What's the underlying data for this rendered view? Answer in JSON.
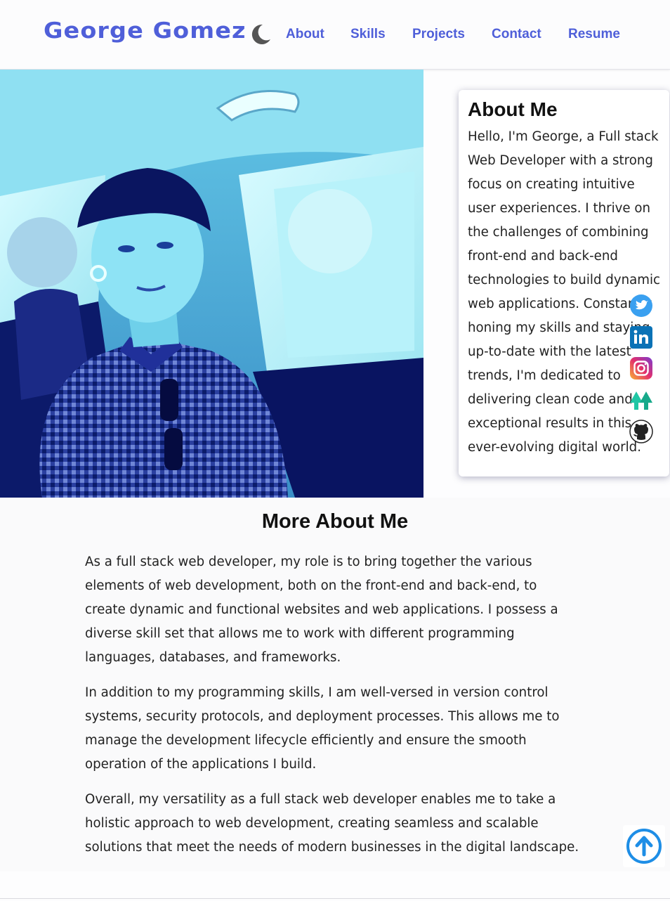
{
  "header": {
    "brand": "George Gomez",
    "theme_toggle_icon": "moon-icon",
    "nav": [
      {
        "label": "About"
      },
      {
        "label": "Skills"
      },
      {
        "label": "Projects"
      },
      {
        "label": "Contact"
      },
      {
        "label": "Resume"
      }
    ],
    "accent_color": "#4f5fd9"
  },
  "about": {
    "title": "About Me",
    "text": "Hello, I'm George, a Full stack Web Developer with a strong focus on creating intuitive user experiences. I thrive on the challenges of combining front-end and back-end technologies to build dynamic web applications. Constantly honing my skills and staying up-to-date with the latest trends, I'm dedicated to delivering clean code and exceptional results in this ever-evolving digital world."
  },
  "social_icons": [
    "twitter-icon",
    "linkedin-icon",
    "instagram-icon",
    "upwork-icon",
    "github-icon"
  ],
  "more": {
    "title": "More About Me",
    "paragraphs": [
      "As a full stack web developer, my role is to bring together the various elements of web development, both on the front-end and back-end, to create dynamic and functional websites and web applications. I possess a diverse skill set that allows me to work with different programming languages, databases, and frameworks.",
      "In addition to my programming skills, I am well-versed in version control systems, security protocols, and deployment processes. This allows me to manage the development lifecycle efficiently and ensure the smooth operation of the applications I build.",
      "Overall, my versatility as a full stack web developer enables me to take a holistic approach to web development, creating seamless and scalable solutions that meet the needs of modern businesses in the digital landscape."
    ]
  },
  "scroll_top_icon": "arrow-up-circle-icon",
  "photo": "profile-photo"
}
